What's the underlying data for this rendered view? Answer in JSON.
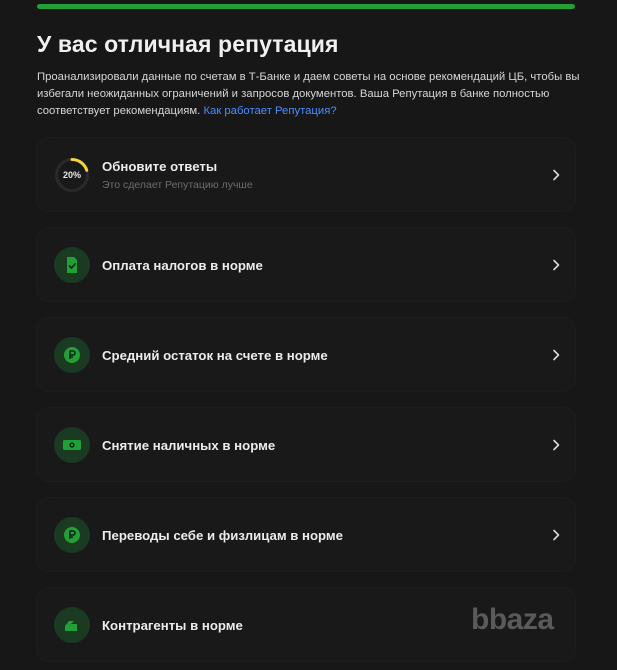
{
  "progress": {
    "value": 1.0,
    "color": "#21a038"
  },
  "header": {
    "title": "У вас отличная репутация",
    "intro_text": "Проанализировали данные по счетам в Т‑Банке и даем советы на основе рекомендаций ЦБ, чтобы вы избегали неожиданных ограничений и запросов документов. Ваша Репутация в банке полностью соответствует рекомендациям.",
    "intro_link": "Как работает Репутация?"
  },
  "cards": [
    {
      "icon": "progress-ring-icon",
      "percent": "20%",
      "percent_value": 20,
      "title": "Обновите ответы",
      "subtitle": "Это сделает Репутацию лучше"
    },
    {
      "icon": "tax-document-icon",
      "title": "Оплата налогов в норме"
    },
    {
      "icon": "ruble-coin-icon",
      "title": "Средний остаток на счете в норме"
    },
    {
      "icon": "cash-banknote-icon",
      "title": "Снятие наличных в норме"
    },
    {
      "icon": "ruble-coin-icon",
      "title": "Переводы себе и физлицам в норме"
    },
    {
      "icon": "counterparty-handshake-icon",
      "title": "Контрагенты в норме"
    }
  ],
  "colors": {
    "accent": "#21a038",
    "ring": "#f5d33a",
    "link": "#4d8dff"
  },
  "watermark": "bbaza"
}
